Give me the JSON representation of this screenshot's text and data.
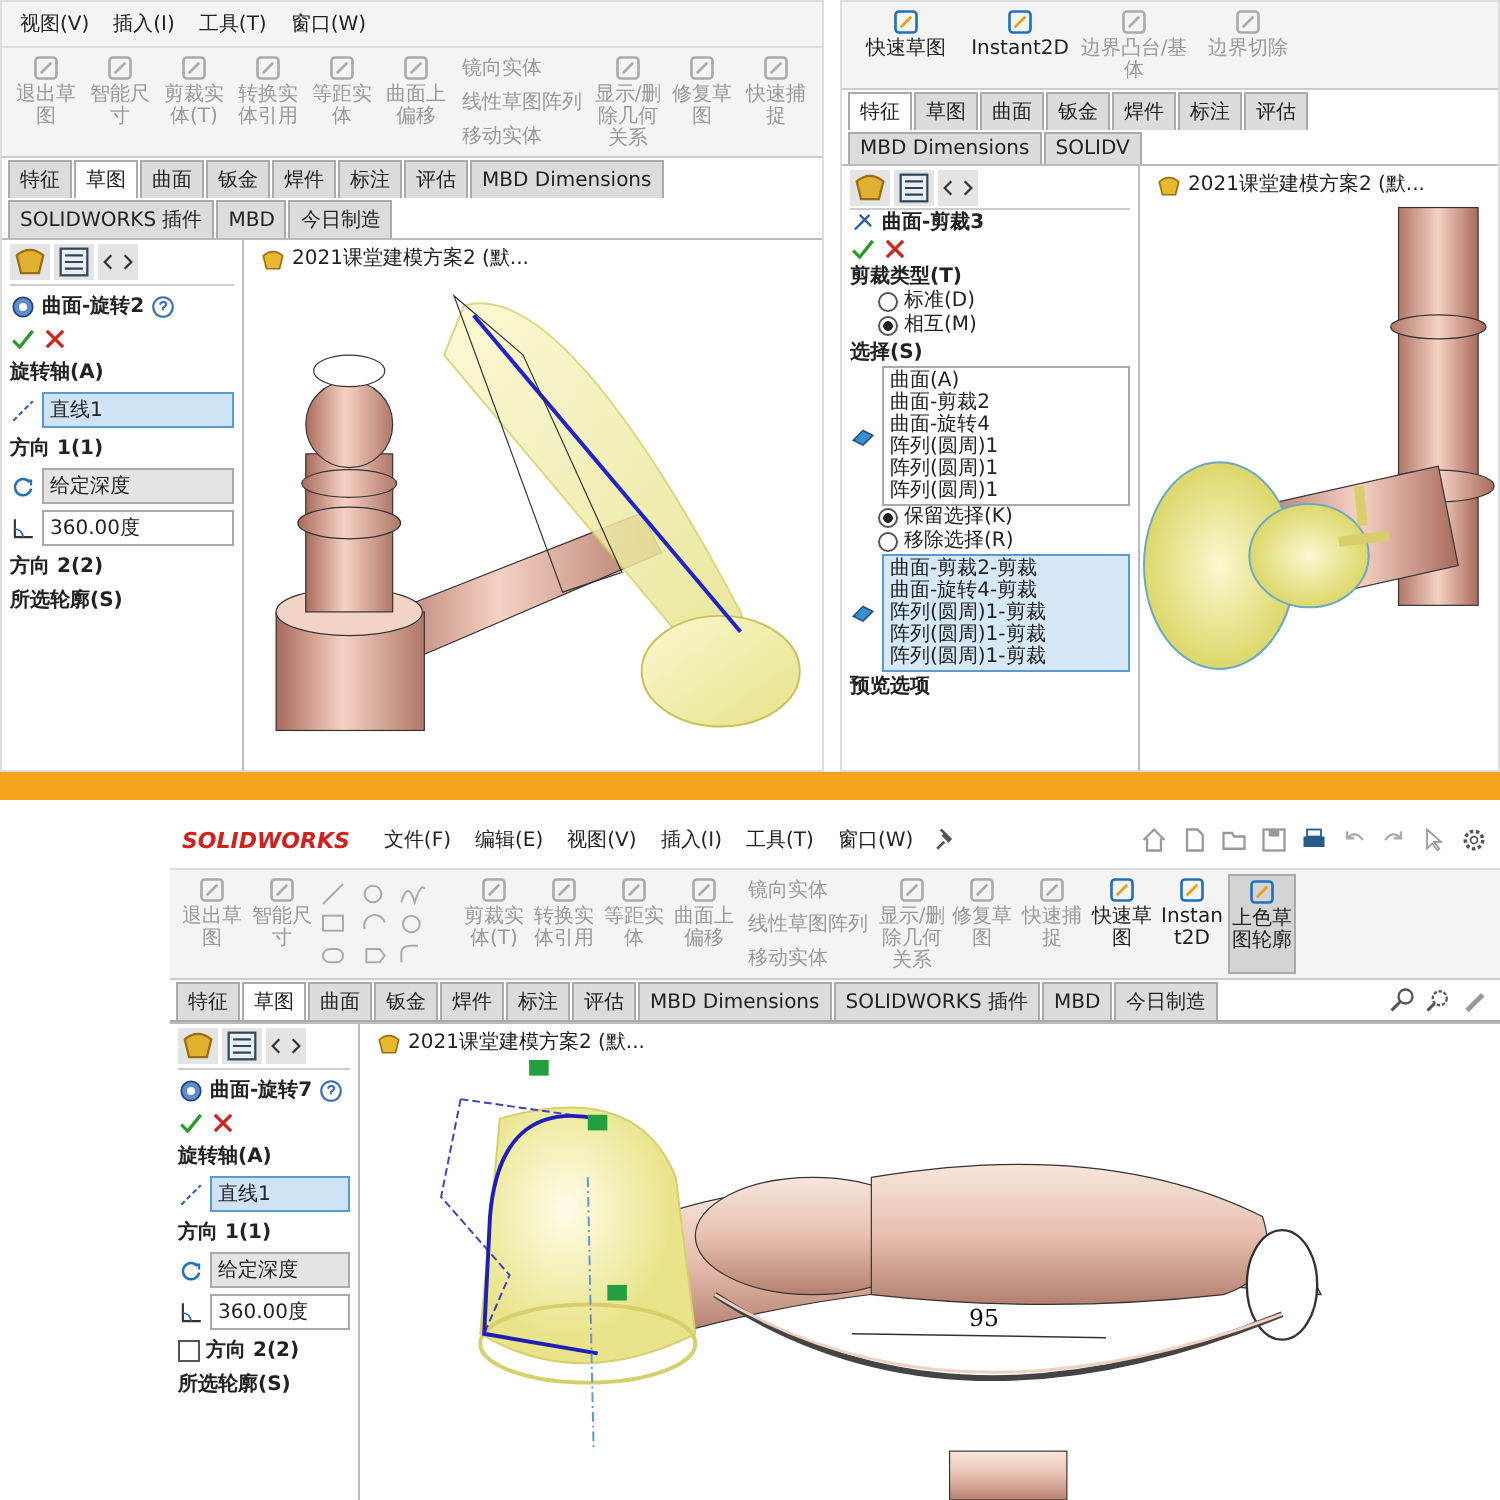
{
  "left_shot": {
    "menu": [
      "视图(V)",
      "插入(I)",
      "工具(T)",
      "窗口(W)"
    ],
    "toolbar": [
      {
        "label": "退出草图",
        "disabled": true
      },
      {
        "label": "智能尺寸",
        "disabled": true
      },
      {
        "label": "剪裁实体(T)",
        "disabled": true
      },
      {
        "label": "转换实体引用",
        "disabled": true
      },
      {
        "label": "等距实体",
        "disabled": true
      },
      {
        "label": "曲面上偏移",
        "disabled": true
      }
    ],
    "sketch_tools": [
      "镜向实体",
      "线性草图阵列",
      "移动实体"
    ],
    "toolbar_right": [
      {
        "label": "显示/删除几何关系",
        "disabled": true
      },
      {
        "label": "修复草图",
        "disabled": true
      },
      {
        "label": "快速捕捉",
        "disabled": true
      }
    ],
    "tabs": [
      {
        "label": "特征",
        "selected": false
      },
      {
        "label": "草图",
        "selected": true
      },
      {
        "label": "曲面",
        "selected": false
      },
      {
        "label": "钣金",
        "selected": false
      },
      {
        "label": "焊件",
        "selected": false
      },
      {
        "label": "标注",
        "selected": false
      },
      {
        "label": "评估",
        "selected": false
      },
      {
        "label": "MBD Dimensions",
        "selected": false
      },
      {
        "label": "SOLIDWORKS 插件",
        "selected": false
      },
      {
        "label": "MBD",
        "selected": false
      },
      {
        "label": "今日制造",
        "selected": false
      }
    ],
    "document": "2021课堂建模方案2 (默...",
    "property_manager": {
      "title": "曲面-旋转2",
      "axis_heading": "旋转轴(A)",
      "axis_value": "直线1",
      "direction1_heading": "方向 1(1)",
      "end_condition": "给定深度",
      "angle": "360.00度",
      "direction2_heading": "方向 2(2)",
      "profiles_heading": "所选轮廓(S)"
    }
  },
  "right_shot": {
    "toolbar": [
      {
        "label": "快速草图",
        "disabled": false
      },
      {
        "label": "Instant2D",
        "disabled": false
      },
      {
        "label": "边界凸台/基体",
        "disabled": true
      },
      {
        "label": "边界切除",
        "disabled": true
      }
    ],
    "tabs": [
      {
        "label": "特征",
        "selected": true
      },
      {
        "label": "草图",
        "selected": false
      },
      {
        "label": "曲面",
        "selected": false
      },
      {
        "label": "钣金",
        "selected": false
      },
      {
        "label": "焊件",
        "selected": false
      },
      {
        "label": "标注",
        "selected": false
      },
      {
        "label": "评估",
        "selected": false
      },
      {
        "label": "MBD Dimensions",
        "selected": false
      },
      {
        "label": "SOLIDV",
        "selected": false
      }
    ],
    "document": "2021课堂建模方案2 (默...",
    "property_manager": {
      "title": "曲面-剪裁3",
      "trim_type_heading": "剪裁类型(T)",
      "trim_types": [
        {
          "label": "标准(D)",
          "selected": false
        },
        {
          "label": "相互(M)",
          "selected": true
        }
      ],
      "selection_heading": "选择(S)",
      "surfaces_label": "曲面(A)",
      "surfaces": [
        "曲面-剪裁2",
        "曲面-旋转4",
        "阵列(圆周)1",
        "阵列(圆周)1",
        "阵列(圆周)1"
      ],
      "keep_options": [
        {
          "label": "保留选择(K)",
          "selected": true
        },
        {
          "label": "移除选择(R)",
          "selected": false
        }
      ],
      "pieces": [
        "曲面-剪裁2-剪裁",
        "曲面-旋转4-剪裁",
        "阵列(圆周)1-剪裁",
        "阵列(圆周)1-剪裁",
        "阵列(圆周)1-剪裁"
      ],
      "preview_heading": "预览选项"
    }
  },
  "main_shot": {
    "brand": "SOLIDWORKS",
    "menu": [
      "文件(F)",
      "编辑(E)",
      "视图(V)",
      "插入(I)",
      "工具(T)",
      "窗口(W)"
    ],
    "toolbar": [
      {
        "label": "退出草图",
        "disabled": true
      },
      {
        "label": "智能尺寸",
        "disabled": true
      }
    ],
    "toolbar_mid": [
      {
        "label": "剪裁实体(T)",
        "disabled": true
      },
      {
        "label": "转换实体引用",
        "disabled": true
      },
      {
        "label": "等距实体",
        "disabled": true
      },
      {
        "label": "曲面上偏移",
        "disabled": true
      }
    ],
    "sketch_tools": [
      "镜向实体",
      "线性草图阵列",
      "移动实体"
    ],
    "toolbar_right": [
      {
        "label": "显示/删除几何关系",
        "disabled": true,
        "selected": false
      },
      {
        "label": "修复草图",
        "disabled": true,
        "selected": false
      },
      {
        "label": "快速捕捉",
        "disabled": true,
        "selected": false
      },
      {
        "label": "快速草图",
        "disabled": false,
        "selected": false
      },
      {
        "label": "Instant2D",
        "disabled": false,
        "selected": false
      },
      {
        "label": "上色草图轮廓",
        "disabled": false,
        "selected": true
      }
    ],
    "tabs": [
      {
        "label": "特征",
        "selected": false
      },
      {
        "label": "草图",
        "selected": true
      },
      {
        "label": "曲面",
        "selected": false
      },
      {
        "label": "钣金",
        "selected": false
      },
      {
        "label": "焊件",
        "selected": false
      },
      {
        "label": "标注",
        "selected": false
      },
      {
        "label": "评估",
        "selected": false
      },
      {
        "label": "MBD Dimensions",
        "selected": false
      },
      {
        "label": "SOLIDWORKS 插件",
        "selected": false
      },
      {
        "label": "MBD",
        "selected": false
      },
      {
        "label": "今日制造",
        "selected": false
      }
    ],
    "document": "2021课堂建模方案2 (默...",
    "property_manager": {
      "title": "曲面-旋转7",
      "axis_heading": "旋转轴(A)",
      "axis_value": "直线1",
      "direction1_heading": "方向 1(1)",
      "end_condition": "给定深度",
      "angle": "360.00度",
      "direction2_heading": "方向 2(2)",
      "direction2_checked": false,
      "profiles_heading": "所选轮廓(S)"
    },
    "dimension": "95"
  }
}
